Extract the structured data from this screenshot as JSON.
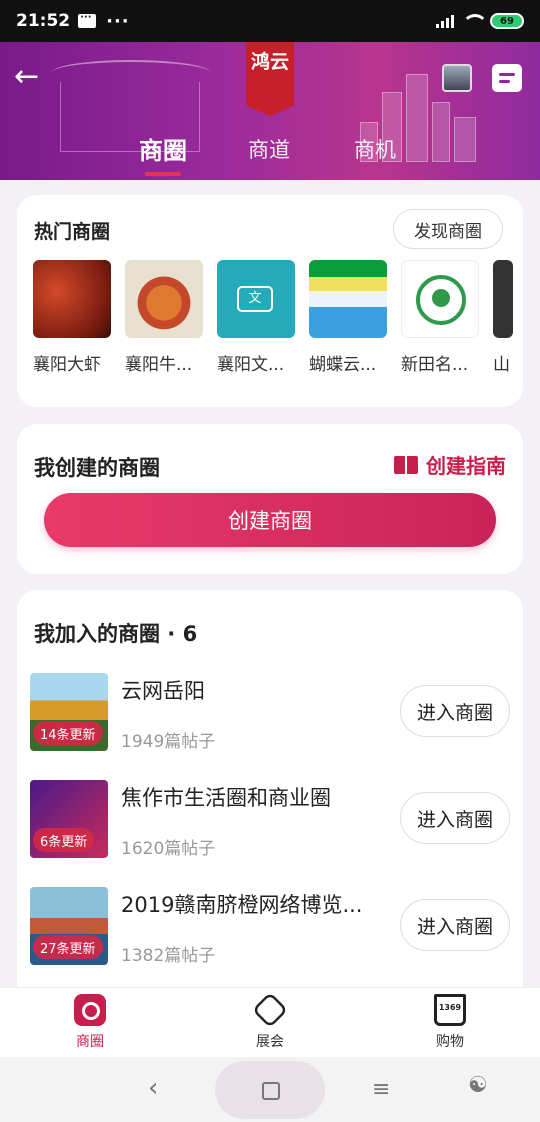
{
  "status_bar": {
    "time": "21:52",
    "dots": "···",
    "battery": "69"
  },
  "header": {
    "logo_text": "鸿云",
    "tabs": [
      {
        "label": "商圈",
        "active": true
      },
      {
        "label": "商道",
        "active": false
      },
      {
        "label": "商机",
        "active": false
      }
    ]
  },
  "hot": {
    "title": "热门商圈",
    "discover_label": "发现商圈",
    "items": [
      {
        "label": "襄阳大虾"
      },
      {
        "label": "襄阳牛..."
      },
      {
        "label": "襄阳文..."
      },
      {
        "label": "蝴蝶云..."
      },
      {
        "label": "新田名..."
      },
      {
        "label": "山"
      }
    ]
  },
  "created": {
    "title": "我创建的商圈",
    "guide_label": "创建指南",
    "create_label": "创建商圈"
  },
  "joined": {
    "title": "我加入的商圈 · 6",
    "enter_label": "进入商圈",
    "rows": [
      {
        "name": "云网岳阳",
        "posts": "1949篇帖子",
        "badge": "14条更新"
      },
      {
        "name": "焦作市生活圈和商业圈",
        "posts": "1620篇帖子",
        "badge": "6条更新"
      },
      {
        "name": "2019赣南脐橙网络博览...",
        "posts": "1382篇帖子",
        "badge": "27条更新"
      }
    ]
  },
  "bottom_nav": [
    {
      "label": "商圈",
      "icon": "circle-home-icon",
      "active": true
    },
    {
      "label": "展会",
      "icon": "expo-icon",
      "active": false
    },
    {
      "label": "购物",
      "icon": "cart-icon",
      "active": false
    }
  ],
  "cart_count": "1369",
  "colors": {
    "accent": "#c81e4e",
    "header_purple": "#8f2a9e"
  }
}
